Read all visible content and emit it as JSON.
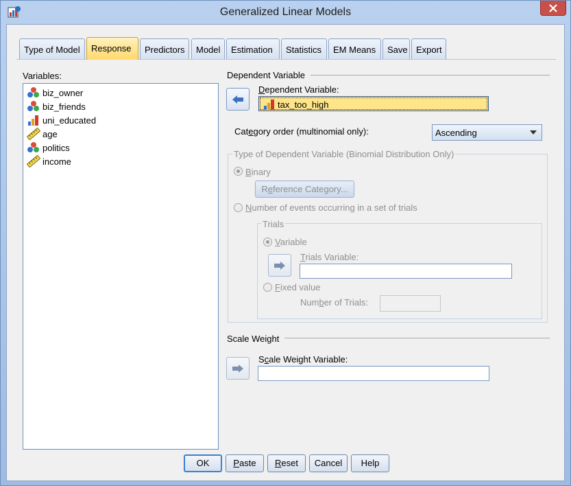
{
  "window": {
    "title": "Generalized Linear Models",
    "close_icon": "close-icon"
  },
  "tabs": [
    {
      "label": "Type of Model"
    },
    {
      "label": "Response"
    },
    {
      "label": "Predictors"
    },
    {
      "label": "Model"
    },
    {
      "label": "Estimation"
    },
    {
      "label": "Statistics"
    },
    {
      "label": "EM Means"
    },
    {
      "label": "Save"
    },
    {
      "label": "Export"
    }
  ],
  "variables": {
    "label": "Variables:",
    "items": [
      {
        "name": "biz_owner",
        "icon": "nominal-icon"
      },
      {
        "name": "biz_friends",
        "icon": "nominal-icon"
      },
      {
        "name": "uni_educated",
        "icon": "ordinal-icon"
      },
      {
        "name": "age",
        "icon": "scale-icon"
      },
      {
        "name": "politics",
        "icon": "nominal-icon"
      },
      {
        "name": "income",
        "icon": "scale-icon"
      }
    ]
  },
  "dependent": {
    "group_title": "Dependent Variable",
    "field_label_pre": "D",
    "field_label_rest": "ependent Variable:",
    "value": "tax_too_high",
    "category_order_pre": "Cat",
    "category_order_u": "e",
    "category_order_rest": "gory order (multinomial only):",
    "category_order_value": "Ascending"
  },
  "type_group": {
    "title": "Type of Dependent Variable (Binomial Distribution Only)",
    "binary_u": "B",
    "binary_rest": "inary",
    "ref_btn_pre": "R",
    "ref_btn_u": "e",
    "ref_btn_rest": "ference Category...",
    "events_u": "N",
    "events_rest": "umber of events occurring in a set of trials",
    "trials_title": "Trials",
    "variable_u": "V",
    "variable_rest": "ariable",
    "trials_var_u": "T",
    "trials_var_rest": "rials Variable:",
    "fixed_u": "F",
    "fixed_rest": "ixed value",
    "num_trials_pre": "Num",
    "num_trials_u": "b",
    "num_trials_rest": "er of Trials:"
  },
  "scale_weight": {
    "group_title": "Scale Weight",
    "field_label_pre": "S",
    "field_label_u": "c",
    "field_label_rest": "ale Weight Variable:"
  },
  "buttons": {
    "ok": "OK",
    "paste_u": "P",
    "paste_rest": "aste",
    "reset_u": "R",
    "reset_rest": "eset",
    "cancel": "Cancel",
    "help": "Help"
  }
}
